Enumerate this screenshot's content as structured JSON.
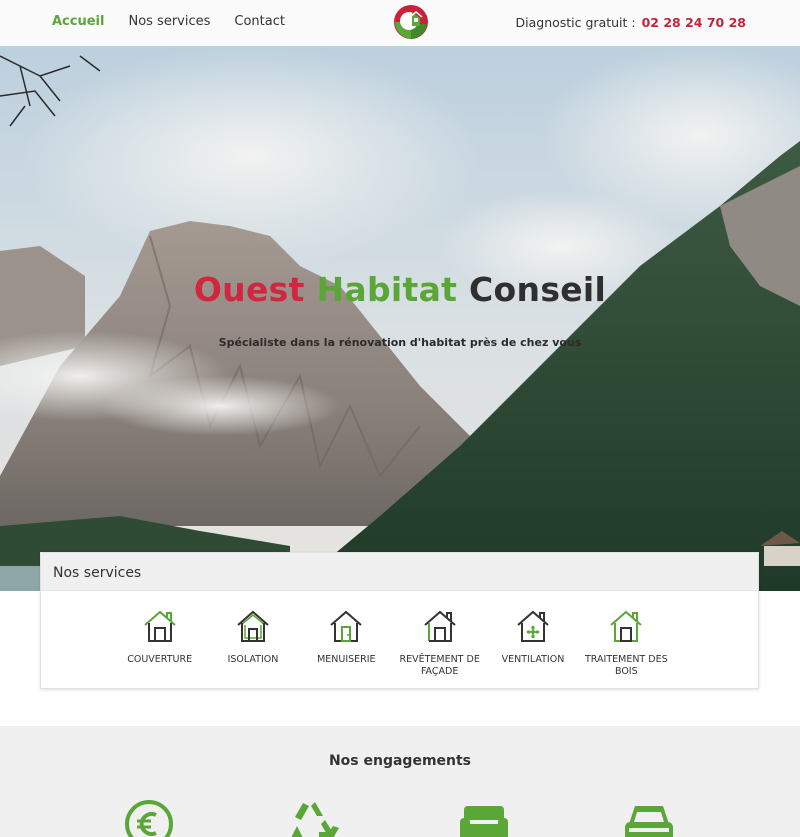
{
  "nav": {
    "links": [
      {
        "label": "Accueil",
        "active": true
      },
      {
        "label": "Nos services",
        "active": false
      },
      {
        "label": "Contact",
        "active": false
      }
    ],
    "logo_icon": "house-leaf-logo",
    "phone_prefix": "Diagnostic gratuit :",
    "phone_number": "02 28 24 70 28"
  },
  "hero": {
    "title_part1": "Ouest",
    "title_part2": "Habitat",
    "title_part3": "Conseil",
    "subtitle": "Spécialiste dans la rénovation d'habitat près de chez vous",
    "background": "mountain-landscape"
  },
  "services": {
    "heading": "Nos services",
    "items": [
      {
        "label": "COUVERTURE",
        "icon": "house-roof-icon"
      },
      {
        "label": "ISOLATION",
        "icon": "house-insulation-icon"
      },
      {
        "label": "MENUISERIE",
        "icon": "house-door-icon"
      },
      {
        "label": "REVÊTEMENT DE FAÇADE",
        "icon": "house-facade-icon"
      },
      {
        "label": "VENTILATION",
        "icon": "house-ventilation-icon"
      },
      {
        "label": "TRAITEMENT DES BOIS",
        "icon": "house-wood-icon"
      }
    ]
  },
  "engagements": {
    "heading": "Nos engagements",
    "icons": [
      "euro-icon",
      "recycle-icon",
      "armchair-icon",
      "car-icon"
    ]
  },
  "colors": {
    "accent_green": "#5aa637",
    "accent_red": "#d2253f"
  }
}
